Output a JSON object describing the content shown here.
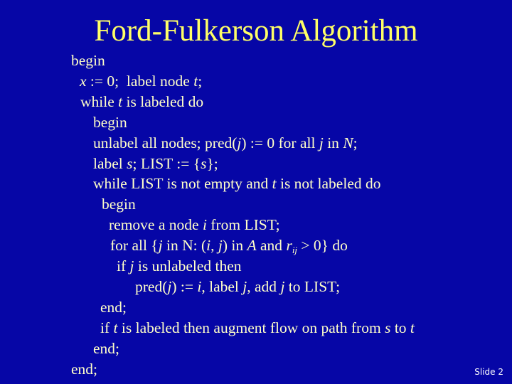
{
  "slide": {
    "title": "Ford-Fulkerson Algorithm",
    "footer": "Slide 2",
    "colors": {
      "background": "#0606a6",
      "title": "#ffff66",
      "body_text": "#ffffc8",
      "footer_text": "#ffffff"
    },
    "lines": [
      {
        "indent_level": 0,
        "segments": [
          {
            "t": "begin"
          }
        ]
      },
      {
        "indent_level": 1,
        "segments": [
          {
            "t": "x",
            "i": true
          },
          {
            "t": " := 0;  label node "
          },
          {
            "t": "t",
            "i": true
          },
          {
            "t": ";"
          }
        ]
      },
      {
        "indent_level": 1,
        "segments": [
          {
            "t": "while "
          },
          {
            "t": "t",
            "i": true
          },
          {
            "t": " is labeled do"
          }
        ]
      },
      {
        "indent_level": 2,
        "segments": [
          {
            "t": "begin"
          }
        ]
      },
      {
        "indent_level": 2,
        "segments": [
          {
            "t": "unlabel all nodes; pred("
          },
          {
            "t": "j",
            "i": true
          },
          {
            "t": ") := 0 for all "
          },
          {
            "t": "j",
            "i": true
          },
          {
            "t": " in "
          },
          {
            "t": "N",
            "i": true
          },
          {
            "t": ";"
          }
        ]
      },
      {
        "indent_level": 2,
        "segments": [
          {
            "t": "label "
          },
          {
            "t": "s",
            "i": true
          },
          {
            "t": "; LIST := {"
          },
          {
            "t": "s",
            "i": true
          },
          {
            "t": "};"
          }
        ]
      },
      {
        "indent_level": 2,
        "segments": [
          {
            "t": "while LIST is not empty and "
          },
          {
            "t": "t",
            "i": true
          },
          {
            "t": " is not labeled do"
          }
        ]
      },
      {
        "indent_level": 3,
        "segments": [
          {
            "t": "begin"
          }
        ]
      },
      {
        "indent_level": 4,
        "segments": [
          {
            "t": "remove a node "
          },
          {
            "t": "i",
            "i": true
          },
          {
            "t": " from LIST;"
          }
        ]
      },
      {
        "indent_level": 4,
        "segments": [
          {
            "t": "for all {"
          },
          {
            "t": "j",
            "i": true
          },
          {
            "t": " in N: ("
          },
          {
            "t": "i",
            "i": true
          },
          {
            "t": ", "
          },
          {
            "t": "j",
            "i": true
          },
          {
            "t": ") in "
          },
          {
            "t": "A",
            "i": true
          },
          {
            "t": " and "
          },
          {
            "t": "r",
            "i": true
          },
          {
            "t": "ij",
            "sub": true
          },
          {
            "t": " > 0} do"
          }
        ]
      },
      {
        "indent_level": 5,
        "segments": [
          {
            "t": "if "
          },
          {
            "t": "j",
            "i": true
          },
          {
            "t": " is unlabeled then"
          }
        ]
      },
      {
        "indent_level": 6,
        "segments": [
          {
            "t": "pred("
          },
          {
            "t": "j",
            "i": true
          },
          {
            "t": ") := "
          },
          {
            "t": "i",
            "i": true
          },
          {
            "t": ", label "
          },
          {
            "t": "j",
            "i": true
          },
          {
            "t": ", add "
          },
          {
            "t": "j",
            "i": true
          },
          {
            "t": " to LIST;"
          }
        ]
      },
      {
        "indent_level": 3,
        "segments": [
          {
            "t": "end;"
          }
        ]
      },
      {
        "indent_level": 3,
        "segments": [
          {
            "t": "if "
          },
          {
            "t": "t",
            "i": true
          },
          {
            "t": " is labeled then augment flow on path from "
          },
          {
            "t": "s",
            "i": true
          },
          {
            "t": " to "
          },
          {
            "t": "t",
            "i": true
          }
        ]
      },
      {
        "indent_level": 2,
        "segments": [
          {
            "t": "end;"
          }
        ]
      },
      {
        "indent_level": 0,
        "segments": [
          {
            "t": "end;"
          }
        ]
      }
    ]
  }
}
